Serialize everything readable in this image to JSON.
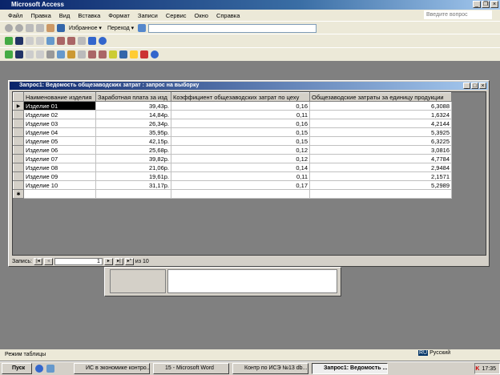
{
  "app": {
    "title": "Microsoft Access",
    "ask_placeholder": "Введите вопрос"
  },
  "menu": [
    "Файл",
    "Правка",
    "Вид",
    "Вставка",
    "Формат",
    "Записи",
    "Сервис",
    "Окно",
    "Справка"
  ],
  "toolbar": {
    "favorites": "Избранное ▾",
    "goto": "Переход ▾"
  },
  "query": {
    "title": "Запрос1: Ведомость общезаводских затрат : запрос на выборку",
    "columns": [
      "Наименование изделия",
      "Заработная плата за изд",
      "Коэффициент общезаводских затрат по цеху",
      "Общезаводские затраты за единицу продукции"
    ],
    "rows": [
      [
        "Изделие 01",
        "39,43р.",
        "0,16",
        "6,3088"
      ],
      [
        "Изделие 02",
        "14,84р.",
        "0,11",
        "1,6324"
      ],
      [
        "Изделие 03",
        "26,34р.",
        "0,16",
        "4,2144"
      ],
      [
        "Изделие 04",
        "35,95р.",
        "0,15",
        "5,3925"
      ],
      [
        "Изделие 05",
        "42,15р.",
        "0,15",
        "6,3225"
      ],
      [
        "Изделие 06",
        "25,68р.",
        "0,12",
        "3,0816"
      ],
      [
        "Изделие 07",
        "39,82р.",
        "0,12",
        "4,7784"
      ],
      [
        "Изделие 08",
        "21,06р.",
        "0,14",
        "2,9484"
      ],
      [
        "Изделие 09",
        "19,61р.",
        "0,11",
        "2,1571"
      ],
      [
        "Изделие 10",
        "31,17р.",
        "0,17",
        "5,2989"
      ]
    ],
    "nav": {
      "label": "Запись:",
      "current": "1",
      "of": "из 10"
    }
  },
  "status": "Режим таблицы",
  "taskbar": {
    "start": "Пуск",
    "tasks": [
      "ИС в экономике контро...",
      "15 - Microsoft Word",
      "Контр по ИСЭ №13 db...",
      "Запрос1: Ведомость ..."
    ],
    "lang": "Русский",
    "lang_code": "RU",
    "clock": "17:35"
  }
}
